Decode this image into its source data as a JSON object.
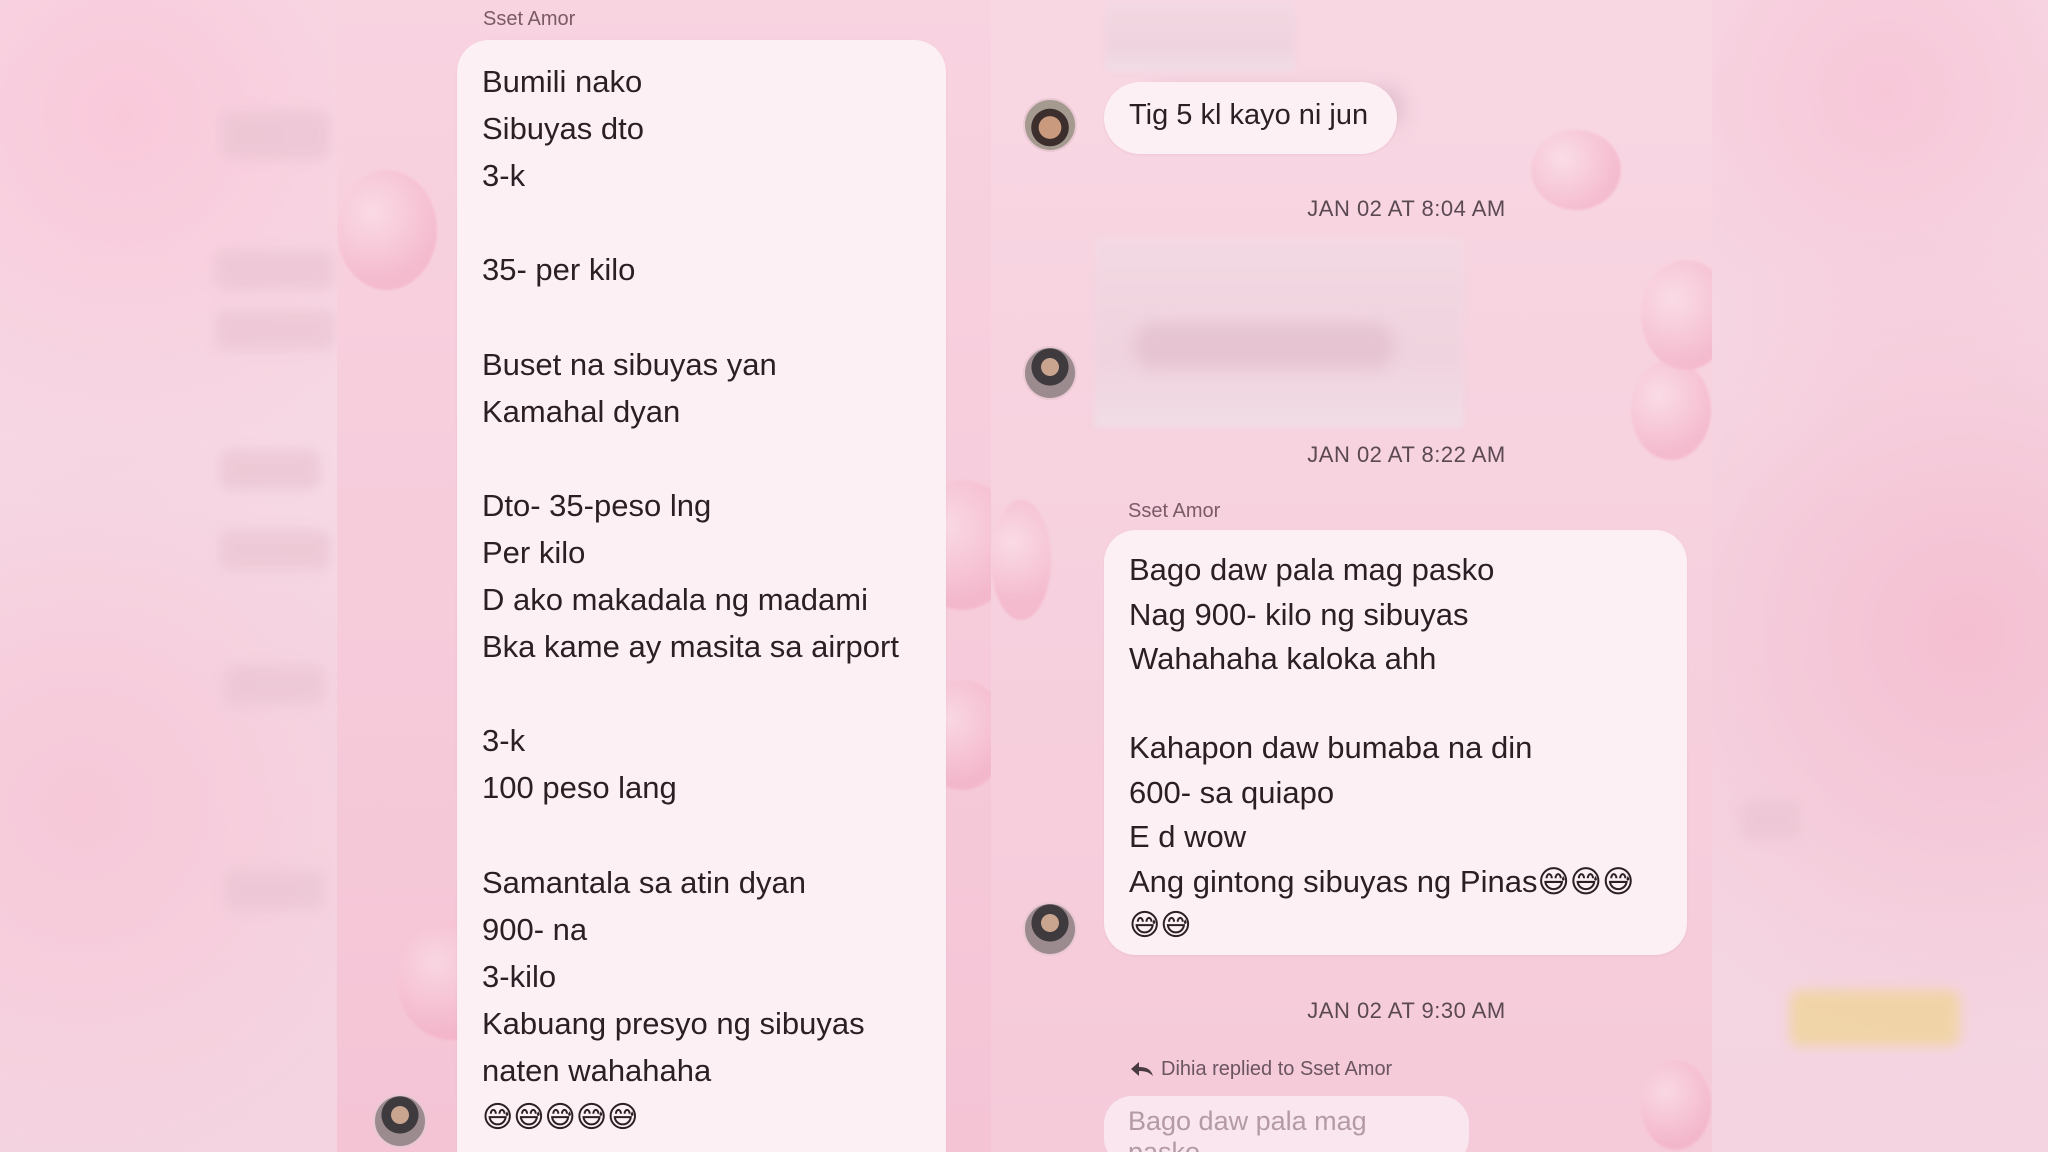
{
  "left_thread": {
    "sender": "Sset Amor",
    "message_lines": [
      "Bumili nako",
      "Sibuyas dto",
      "3-k",
      "",
      "35- per kilo",
      "",
      "Buset na sibuyas yan",
      "Kamahal dyan",
      "",
      "Dto- 35-peso lng",
      "Per kilo",
      "D ako makadala ng madami",
      "Bka kame ay masita sa airport",
      "",
      "3-k",
      "100 peso lang",
      "",
      "Samantala sa atin dyan",
      "900- na",
      "3-kilo",
      "Kabuang presyo ng sibuyas",
      "naten wahahaha"
    ],
    "emoji_line": "😅😅😅😅😅"
  },
  "right_thread": {
    "msg_tig5": "Tig 5 kl kayo ni jun",
    "timestamp_1": "JAN 02 AT 8:04 AM",
    "timestamp_2": "JAN 02 AT 8:22 AM",
    "sender": "Sset Amor",
    "message_lines": [
      "Bago daw pala mag pasko",
      "Nag 900- kilo ng sibuyas",
      "Wahahaha kaloka ahh",
      "",
      "Kahapon daw bumaba na din",
      "600- sa quiapo",
      "E d wow",
      "Ang gintong sibuyas ng Pinas😅😅😅"
    ],
    "emoji_line": "😅😅",
    "timestamp_3": "JAN 02 AT 9:30 AM",
    "reply_label": "Dihia replied to Sset Amor",
    "quoted_text": "Bago daw pala mag pasko",
    "icons": {
      "reply": "reply-arrow-icon"
    }
  },
  "colors": {
    "bubble": "#fdf0f4",
    "background": "#f6dbe6",
    "text": "#2a1f24",
    "timestamp": "#5b4951"
  }
}
